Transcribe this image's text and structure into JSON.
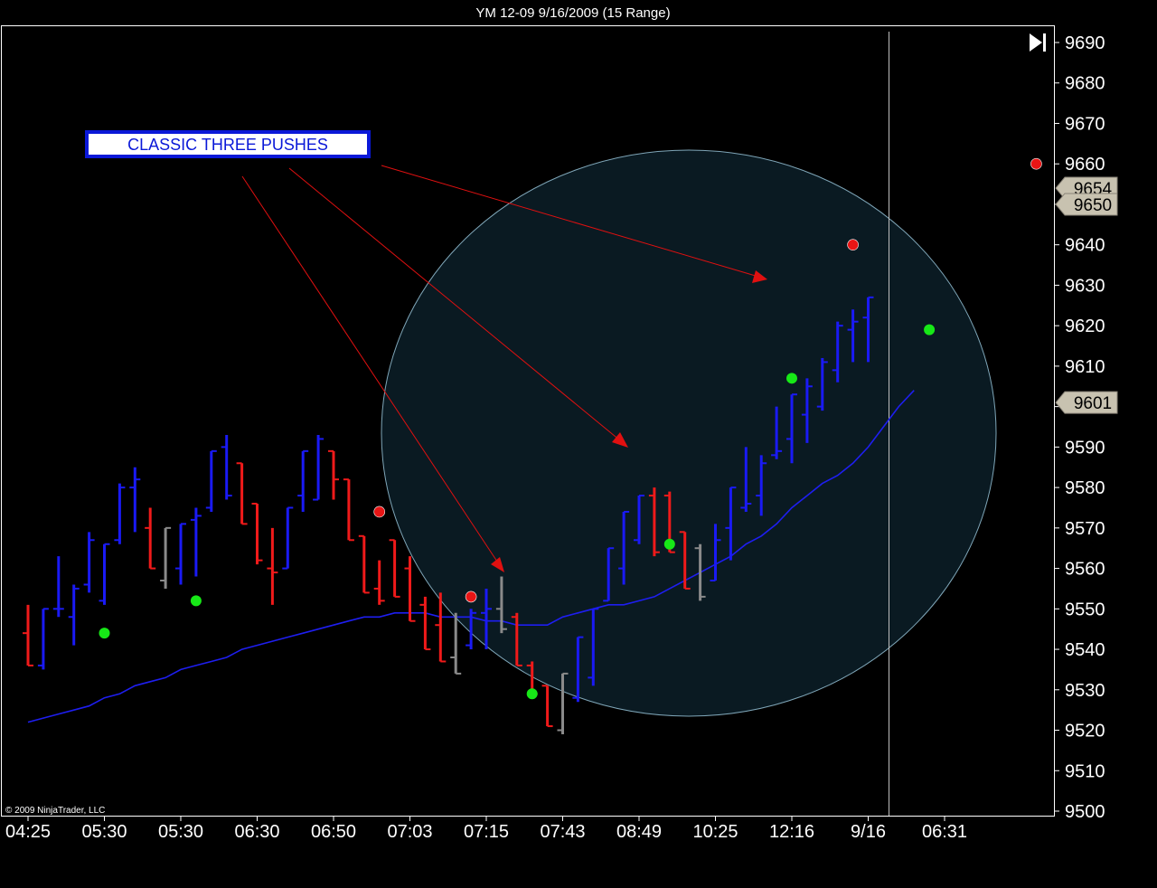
{
  "chart_data": {
    "type": "ohlc",
    "title": "YM 12-09  9/16/2009 (15 Range)",
    "copyright": "© 2009 NinjaTrader, LLC",
    "ylim": [
      9500,
      9690
    ],
    "yticks": [
      9500,
      9510,
      9520,
      9530,
      9540,
      9550,
      9560,
      9570,
      9580,
      9590,
      9600,
      9610,
      9620,
      9630,
      9640,
      9650,
      9660,
      9670,
      9680,
      9690
    ],
    "xticks": [
      {
        "label": "04:25",
        "bar": 0
      },
      {
        "label": "05:30",
        "bar": 5
      },
      {
        "label": "05:30",
        "bar": 10
      },
      {
        "label": "06:30",
        "bar": 15
      },
      {
        "label": "06:50",
        "bar": 20
      },
      {
        "label": "07:03",
        "bar": 25
      },
      {
        "label": "07:15",
        "bar": 30
      },
      {
        "label": "07:43",
        "bar": 35
      },
      {
        "label": "08:49",
        "bar": 40
      },
      {
        "label": "10:25",
        "bar": 45
      },
      {
        "label": "12:16",
        "bar": 50
      },
      {
        "label": "9/16",
        "bar": 55
      },
      {
        "label": "06:31",
        "bar": 60
      }
    ],
    "grid": false,
    "colors": {
      "background": "#000000",
      "up": "#1a1af5",
      "down": "#f01a1a",
      "neutral": "#8a8a8a",
      "moving_average": "#1e1ef0",
      "moving_average_falling": "#d02020",
      "dot_buy": "#17e817",
      "dot_sell": "#e81515",
      "circle_fill": "#0a1a22",
      "circle_stroke": "#7fa6b8",
      "arrow": "#e01010",
      "cursor_line": "#bfbfbf",
      "price_marker": "#c8c2b0"
    },
    "series": [
      {
        "name": "price bars",
        "kind": "ohlc",
        "bars": [
          {
            "o": 9544,
            "h": 9551,
            "l": 9536,
            "c": 9536,
            "dir": "down"
          },
          {
            "o": 9536,
            "h": 9550,
            "l": 9535,
            "c": 9550,
            "dir": "up"
          },
          {
            "o": 9550,
            "h": 9563,
            "l": 9548,
            "c": 9550,
            "dir": "up"
          },
          {
            "o": 9548,
            "h": 9556,
            "l": 9541,
            "c": 9555,
            "dir": "up"
          },
          {
            "o": 9556,
            "h": 9569,
            "l": 9554,
            "c": 9567,
            "dir": "up"
          },
          {
            "o": 9552,
            "h": 9566,
            "l": 9551,
            "c": 9566,
            "dir": "up"
          },
          {
            "o": 9567,
            "h": 9581,
            "l": 9566,
            "c": 9580,
            "dir": "up"
          },
          {
            "o": 9580,
            "h": 9585,
            "l": 9569,
            "c": 9582,
            "dir": "up"
          },
          {
            "o": 9570,
            "h": 9575,
            "l": 9560,
            "c": 9560,
            "dir": "down"
          },
          {
            "o": 9557,
            "h": 9570,
            "l": 9555,
            "c": 9570,
            "dir": "neutral"
          },
          {
            "o": 9560,
            "h": 9571,
            "l": 9556,
            "c": 9571,
            "dir": "up"
          },
          {
            "o": 9572,
            "h": 9575,
            "l": 9558,
            "c": 9573,
            "dir": "up"
          },
          {
            "o": 9575,
            "h": 9589,
            "l": 9574,
            "c": 9589,
            "dir": "up"
          },
          {
            "o": 9590,
            "h": 9593,
            "l": 9577,
            "c": 9578,
            "dir": "up"
          },
          {
            "o": 9586,
            "h": 9586,
            "l": 9571,
            "c": 9571,
            "dir": "down"
          },
          {
            "o": 9576,
            "h": 9576,
            "l": 9561,
            "c": 9562,
            "dir": "down"
          },
          {
            "o": 9560,
            "h": 9570,
            "l": 9551,
            "c": 9559,
            "dir": "down"
          },
          {
            "o": 9560,
            "h": 9575,
            "l": 9560,
            "c": 9575,
            "dir": "up"
          },
          {
            "o": 9578,
            "h": 9589,
            "l": 9574,
            "c": 9589,
            "dir": "up"
          },
          {
            "o": 9577,
            "h": 9593,
            "l": 9577,
            "c": 9592,
            "dir": "up"
          },
          {
            "o": 9589,
            "h": 9589,
            "l": 9577,
            "c": 9582,
            "dir": "down"
          },
          {
            "o": 9582,
            "h": 9582,
            "l": 9567,
            "c": 9567,
            "dir": "down"
          },
          {
            "o": 9568,
            "h": 9568,
            "l": 9554,
            "c": 9554,
            "dir": "down"
          },
          {
            "o": 9555,
            "h": 9562,
            "l": 9551,
            "c": 9552,
            "dir": "down"
          },
          {
            "o": 9567,
            "h": 9567,
            "l": 9553,
            "c": 9553,
            "dir": "down"
          },
          {
            "o": 9560,
            "h": 9563,
            "l": 9547,
            "c": 9547,
            "dir": "down"
          },
          {
            "o": 9551,
            "h": 9553,
            "l": 9540,
            "c": 9540,
            "dir": "down"
          },
          {
            "o": 9546,
            "h": 9554,
            "l": 9537,
            "c": 9537,
            "dir": "down"
          },
          {
            "o": 9538,
            "h": 9549,
            "l": 9534,
            "c": 9534,
            "dir": "neutral"
          },
          {
            "o": 9541,
            "h": 9550,
            "l": 9540,
            "c": 9549,
            "dir": "up"
          },
          {
            "o": 9549,
            "h": 9555,
            "l": 9540,
            "c": 9550,
            "dir": "up"
          },
          {
            "o": 9550,
            "h": 9558,
            "l": 9544,
            "c": 9545,
            "dir": "neutral"
          },
          {
            "o": 9548,
            "h": 9549,
            "l": 9536,
            "c": 9536,
            "dir": "down"
          },
          {
            "o": 9536,
            "h": 9537,
            "l": 9529,
            "c": 9529,
            "dir": "down"
          },
          {
            "o": 9531,
            "h": 9531,
            "l": 9521,
            "c": 9521,
            "dir": "down"
          },
          {
            "o": 9520,
            "h": 9534,
            "l": 9519,
            "c": 9534,
            "dir": "neutral"
          },
          {
            "o": 9528,
            "h": 9543,
            "l": 9527,
            "c": 9543,
            "dir": "up"
          },
          {
            "o": 9533,
            "h": 9550,
            "l": 9531,
            "c": 9550,
            "dir": "up"
          },
          {
            "o": 9552,
            "h": 9565,
            "l": 9552,
            "c": 9565,
            "dir": "up"
          },
          {
            "o": 9560,
            "h": 9574,
            "l": 9556,
            "c": 9574,
            "dir": "up"
          },
          {
            "o": 9567,
            "h": 9578,
            "l": 9566,
            "c": 9578,
            "dir": "up"
          },
          {
            "o": 9578,
            "h": 9580,
            "l": 9563,
            "c": 9564,
            "dir": "down"
          },
          {
            "o": 9578,
            "h": 9579,
            "l": 9564,
            "c": 9564,
            "dir": "down"
          },
          {
            "o": 9569,
            "h": 9569,
            "l": 9555,
            "c": 9555,
            "dir": "down"
          },
          {
            "o": 9565,
            "h": 9566,
            "l": 9552,
            "c": 9553,
            "dir": "neutral"
          },
          {
            "o": 9557,
            "h": 9571,
            "l": 9557,
            "c": 9567,
            "dir": "up"
          },
          {
            "o": 9570,
            "h": 9580,
            "l": 9562,
            "c": 9580,
            "dir": "up"
          },
          {
            "o": 9575,
            "h": 9590,
            "l": 9574,
            "c": 9576,
            "dir": "up"
          },
          {
            "o": 9578,
            "h": 9588,
            "l": 9573,
            "c": 9586,
            "dir": "up"
          },
          {
            "o": 9588,
            "h": 9600,
            "l": 9587,
            "c": 9589,
            "dir": "up"
          },
          {
            "o": 9592,
            "h": 9603,
            "l": 9586,
            "c": 9603,
            "dir": "up"
          },
          {
            "o": 9598,
            "h": 9607,
            "l": 9591,
            "c": 9605,
            "dir": "up"
          },
          {
            "o": 9600,
            "h": 9612,
            "l": 9599,
            "c": 9611,
            "dir": "up"
          },
          {
            "o": 9609,
            "h": 9621,
            "l": 9606,
            "c": 9620,
            "dir": "up"
          },
          {
            "o": 9619,
            "h": 9624,
            "l": 9611,
            "c": 9621,
            "dir": "up"
          },
          {
            "o": 9622,
            "h": 9627,
            "l": 9611,
            "c": 9627,
            "dir": "up"
          }
        ]
      },
      {
        "name": "moving average",
        "kind": "line",
        "x_start": 0,
        "values": [
          9522,
          9523,
          9524,
          9525,
          9526,
          9528,
          9529,
          9531,
          9532,
          9533,
          9535,
          9536,
          9537,
          9538,
          9540,
          9541,
          9542,
          9543,
          9544,
          9545,
          9546,
          9547,
          9548,
          9548,
          9549,
          9549,
          9549,
          9548,
          9548,
          9548,
          9547,
          9547,
          9546,
          9546,
          9546,
          9548,
          9549,
          9550,
          9551,
          9551,
          9552,
          9553,
          9555,
          9557,
          9559,
          9561,
          9563,
          9566,
          9568,
          9571,
          9575,
          9578,
          9581,
          9583,
          9586,
          9590,
          9595,
          9600,
          9604
        ]
      }
    ],
    "signal_dots": [
      {
        "bar": 5,
        "price": 9544,
        "kind": "buy"
      },
      {
        "bar": 11,
        "price": 9552,
        "kind": "buy"
      },
      {
        "bar": 23,
        "price": 9574,
        "kind": "sell"
      },
      {
        "bar": 29,
        "price": 9553,
        "kind": "sell"
      },
      {
        "bar": 33,
        "price": 9529,
        "kind": "buy"
      },
      {
        "bar": 42,
        "price": 9566,
        "kind": "buy"
      },
      {
        "bar": 50,
        "price": 9607,
        "kind": "buy"
      },
      {
        "bar": 54,
        "price": 9640,
        "kind": "sell"
      },
      {
        "bar": 59,
        "price": 9619,
        "kind": "buy"
      },
      {
        "bar": 66,
        "price": 9660,
        "kind": "sell"
      }
    ],
    "annotation": {
      "label": "CLASSIC THREE PUSHES"
    },
    "price_markers": [
      {
        "label": "9654",
        "value": 9654
      },
      {
        "label": "9650",
        "value": 9650
      },
      {
        "label": "9601",
        "value": 9601
      }
    ]
  }
}
